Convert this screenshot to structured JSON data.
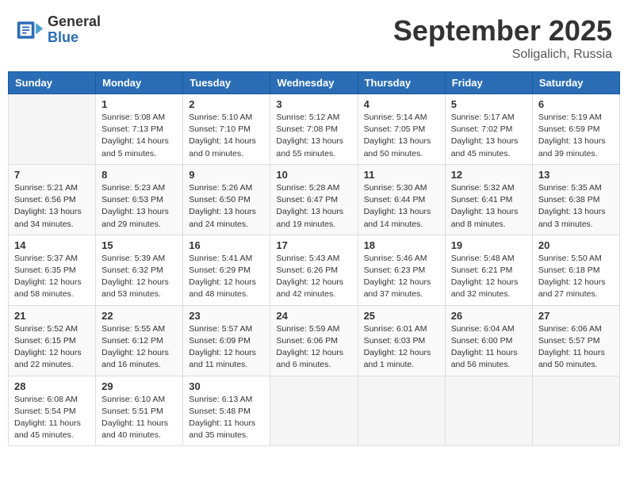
{
  "header": {
    "logo_general": "General",
    "logo_blue": "Blue",
    "month_title": "September 2025",
    "location": "Soligalich, Russia"
  },
  "columns": [
    "Sunday",
    "Monday",
    "Tuesday",
    "Wednesday",
    "Thursday",
    "Friday",
    "Saturday"
  ],
  "weeks": [
    [
      {
        "day": "",
        "sunrise": "",
        "sunset": "",
        "daylight": ""
      },
      {
        "day": "1",
        "sunrise": "Sunrise: 5:08 AM",
        "sunset": "Sunset: 7:13 PM",
        "daylight": "Daylight: 14 hours and 5 minutes."
      },
      {
        "day": "2",
        "sunrise": "Sunrise: 5:10 AM",
        "sunset": "Sunset: 7:10 PM",
        "daylight": "Daylight: 14 hours and 0 minutes."
      },
      {
        "day": "3",
        "sunrise": "Sunrise: 5:12 AM",
        "sunset": "Sunset: 7:08 PM",
        "daylight": "Daylight: 13 hours and 55 minutes."
      },
      {
        "day": "4",
        "sunrise": "Sunrise: 5:14 AM",
        "sunset": "Sunset: 7:05 PM",
        "daylight": "Daylight: 13 hours and 50 minutes."
      },
      {
        "day": "5",
        "sunrise": "Sunrise: 5:17 AM",
        "sunset": "Sunset: 7:02 PM",
        "daylight": "Daylight: 13 hours and 45 minutes."
      },
      {
        "day": "6",
        "sunrise": "Sunrise: 5:19 AM",
        "sunset": "Sunset: 6:59 PM",
        "daylight": "Daylight: 13 hours and 39 minutes."
      }
    ],
    [
      {
        "day": "7",
        "sunrise": "Sunrise: 5:21 AM",
        "sunset": "Sunset: 6:56 PM",
        "daylight": "Daylight: 13 hours and 34 minutes."
      },
      {
        "day": "8",
        "sunrise": "Sunrise: 5:23 AM",
        "sunset": "Sunset: 6:53 PM",
        "daylight": "Daylight: 13 hours and 29 minutes."
      },
      {
        "day": "9",
        "sunrise": "Sunrise: 5:26 AM",
        "sunset": "Sunset: 6:50 PM",
        "daylight": "Daylight: 13 hours and 24 minutes."
      },
      {
        "day": "10",
        "sunrise": "Sunrise: 5:28 AM",
        "sunset": "Sunset: 6:47 PM",
        "daylight": "Daylight: 13 hours and 19 minutes."
      },
      {
        "day": "11",
        "sunrise": "Sunrise: 5:30 AM",
        "sunset": "Sunset: 6:44 PM",
        "daylight": "Daylight: 13 hours and 14 minutes."
      },
      {
        "day": "12",
        "sunrise": "Sunrise: 5:32 AM",
        "sunset": "Sunset: 6:41 PM",
        "daylight": "Daylight: 13 hours and 8 minutes."
      },
      {
        "day": "13",
        "sunrise": "Sunrise: 5:35 AM",
        "sunset": "Sunset: 6:38 PM",
        "daylight": "Daylight: 13 hours and 3 minutes."
      }
    ],
    [
      {
        "day": "14",
        "sunrise": "Sunrise: 5:37 AM",
        "sunset": "Sunset: 6:35 PM",
        "daylight": "Daylight: 12 hours and 58 minutes."
      },
      {
        "day": "15",
        "sunrise": "Sunrise: 5:39 AM",
        "sunset": "Sunset: 6:32 PM",
        "daylight": "Daylight: 12 hours and 53 minutes."
      },
      {
        "day": "16",
        "sunrise": "Sunrise: 5:41 AM",
        "sunset": "Sunset: 6:29 PM",
        "daylight": "Daylight: 12 hours and 48 minutes."
      },
      {
        "day": "17",
        "sunrise": "Sunrise: 5:43 AM",
        "sunset": "Sunset: 6:26 PM",
        "daylight": "Daylight: 12 hours and 42 minutes."
      },
      {
        "day": "18",
        "sunrise": "Sunrise: 5:46 AM",
        "sunset": "Sunset: 6:23 PM",
        "daylight": "Daylight: 12 hours and 37 minutes."
      },
      {
        "day": "19",
        "sunrise": "Sunrise: 5:48 AM",
        "sunset": "Sunset: 6:21 PM",
        "daylight": "Daylight: 12 hours and 32 minutes."
      },
      {
        "day": "20",
        "sunrise": "Sunrise: 5:50 AM",
        "sunset": "Sunset: 6:18 PM",
        "daylight": "Daylight: 12 hours and 27 minutes."
      }
    ],
    [
      {
        "day": "21",
        "sunrise": "Sunrise: 5:52 AM",
        "sunset": "Sunset: 6:15 PM",
        "daylight": "Daylight: 12 hours and 22 minutes."
      },
      {
        "day": "22",
        "sunrise": "Sunrise: 5:55 AM",
        "sunset": "Sunset: 6:12 PM",
        "daylight": "Daylight: 12 hours and 16 minutes."
      },
      {
        "day": "23",
        "sunrise": "Sunrise: 5:57 AM",
        "sunset": "Sunset: 6:09 PM",
        "daylight": "Daylight: 12 hours and 11 minutes."
      },
      {
        "day": "24",
        "sunrise": "Sunrise: 5:59 AM",
        "sunset": "Sunset: 6:06 PM",
        "daylight": "Daylight: 12 hours and 6 minutes."
      },
      {
        "day": "25",
        "sunrise": "Sunrise: 6:01 AM",
        "sunset": "Sunset: 6:03 PM",
        "daylight": "Daylight: 12 hours and 1 minute."
      },
      {
        "day": "26",
        "sunrise": "Sunrise: 6:04 AM",
        "sunset": "Sunset: 6:00 PM",
        "daylight": "Daylight: 11 hours and 56 minutes."
      },
      {
        "day": "27",
        "sunrise": "Sunrise: 6:06 AM",
        "sunset": "Sunset: 5:57 PM",
        "daylight": "Daylight: 11 hours and 50 minutes."
      }
    ],
    [
      {
        "day": "28",
        "sunrise": "Sunrise: 6:08 AM",
        "sunset": "Sunset: 5:54 PM",
        "daylight": "Daylight: 11 hours and 45 minutes."
      },
      {
        "day": "29",
        "sunrise": "Sunrise: 6:10 AM",
        "sunset": "Sunset: 5:51 PM",
        "daylight": "Daylight: 11 hours and 40 minutes."
      },
      {
        "day": "30",
        "sunrise": "Sunrise: 6:13 AM",
        "sunset": "Sunset: 5:48 PM",
        "daylight": "Daylight: 11 hours and 35 minutes."
      },
      {
        "day": "",
        "sunrise": "",
        "sunset": "",
        "daylight": ""
      },
      {
        "day": "",
        "sunrise": "",
        "sunset": "",
        "daylight": ""
      },
      {
        "day": "",
        "sunrise": "",
        "sunset": "",
        "daylight": ""
      },
      {
        "day": "",
        "sunrise": "",
        "sunset": "",
        "daylight": ""
      }
    ]
  ]
}
